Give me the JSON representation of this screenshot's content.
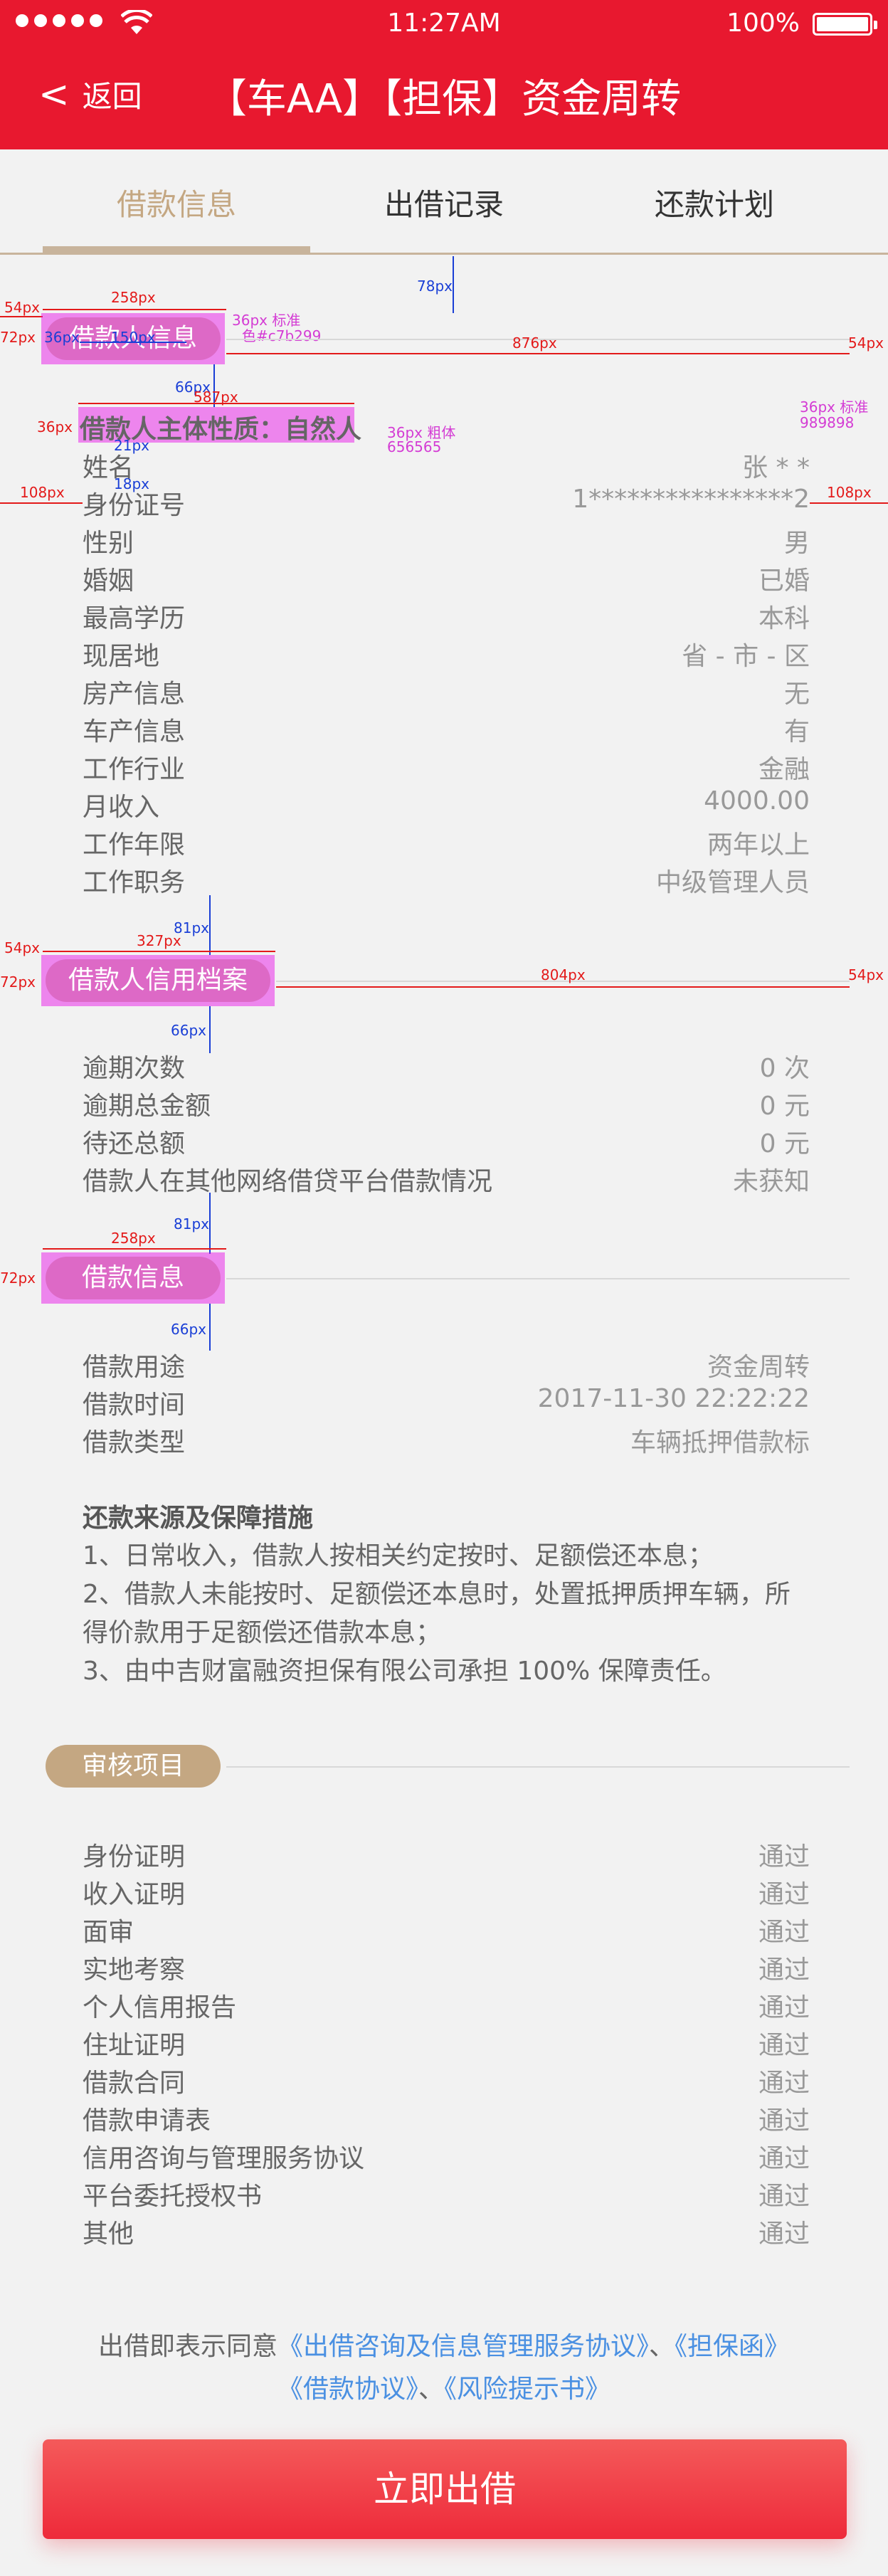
{
  "status_bar": {
    "time": "11:27AM",
    "battery": "100%"
  },
  "nav": {
    "back_label": "返回",
    "title": "【车AA】【担保】资金周转"
  },
  "tabs": [
    {
      "label": "借款信息",
      "active": true
    },
    {
      "label": "出借记录",
      "active": false
    },
    {
      "label": "还款计划",
      "active": false
    }
  ],
  "section1": {
    "pill": "借款人信息",
    "subtitle": "借款人主体性质：自然人"
  },
  "borrower": [
    {
      "label": "姓名",
      "value": "张 * *"
    },
    {
      "label": "身份证号",
      "value": "1****************2"
    },
    {
      "label": "性别",
      "value": "男"
    },
    {
      "label": "婚姻",
      "value": "已婚"
    },
    {
      "label": "最高学历",
      "value": "本科"
    },
    {
      "label": "现居地",
      "value": "省 - 市 - 区"
    },
    {
      "label": "房产信息",
      "value": "无"
    },
    {
      "label": "车产信息",
      "value": "有"
    },
    {
      "label": "工作行业",
      "value": "金融"
    },
    {
      "label": "月收入",
      "value": "4000.00"
    },
    {
      "label": "工作年限",
      "value": "两年以上"
    },
    {
      "label": "工作职务",
      "value": "中级管理人员"
    }
  ],
  "section2": {
    "pill": "借款人信用档案"
  },
  "credit": [
    {
      "label": "逾期次数",
      "value": "0 次"
    },
    {
      "label": "逾期总金额",
      "value": "0 元"
    },
    {
      "label": "待还总额",
      "value": "0 元"
    },
    {
      "label": "借款人在其他网络借贷平台借款情况",
      "value": "未获知"
    }
  ],
  "section3": {
    "pill": "借款信息"
  },
  "loan": [
    {
      "label": "借款用途",
      "value": "资金周转"
    },
    {
      "label": "借款时间",
      "value": "2017-11-30 22:22:22"
    },
    {
      "label": "借款类型",
      "value": "车辆抵押借款标"
    }
  ],
  "repayment": {
    "heading": "还款来源及保障措施",
    "p1": "1、日常收入，借款人按相关约定按时、足额偿还本息；",
    "p2": "2、借款人未能按时、足额偿还本息时，处置抵押质押车辆，所得价款用于足额偿还借款本息；",
    "p3": "3、由中吉财富融资担保有限公司承担 100% 保障责任。"
  },
  "section4": {
    "pill": "审核项目"
  },
  "audit": [
    {
      "label": "身份证明",
      "value": "通过"
    },
    {
      "label": "收入证明",
      "value": "通过"
    },
    {
      "label": "面审",
      "value": "通过"
    },
    {
      "label": "实地考察",
      "value": "通过"
    },
    {
      "label": "个人信用报告",
      "value": "通过"
    },
    {
      "label": "住址证明",
      "value": "通过"
    },
    {
      "label": "借款合同",
      "value": "通过"
    },
    {
      "label": "借款申请表",
      "value": "通过"
    },
    {
      "label": "信用咨询与管理服务协议",
      "value": "通过"
    },
    {
      "label": "平台委托授权书",
      "value": "通过"
    },
    {
      "label": "其他",
      "value": "通过"
    }
  ],
  "agreement": {
    "prefix": "出借即表示同意",
    "link1": "《出借咨询及信息管理服务协议》",
    "sep1": "、",
    "link2": "《担保函》",
    "link3": "《借款协议》",
    "sep2": "、",
    "link4": "《风险提示书》"
  },
  "cta": "立即出借",
  "annotations": {
    "a_54px_1": "54px",
    "a_258px_1": "258px",
    "a_36px_std": "36px 标准",
    "a_color_1": "色#c7b299",
    "a_72px_1": "72px",
    "a_36px_1": "36px",
    "a_150px": "150px",
    "a_876px": "876px",
    "a_54px_r1": "54px",
    "a_78px": "78px",
    "a_66px_1": "66px",
    "a_587px": "587px",
    "a_36px_side": "36px",
    "a_36px_bold": "36px 粗体",
    "a_656565": "656565",
    "a_36px_std2": "36px 标准",
    "a_989898": "989898",
    "a_21px": "21px",
    "a_18px": "18px",
    "a_108px_l": "108px",
    "a_108px_r": "108px",
    "a_81px_1": "81px",
    "a_54px_2": "54px",
    "a_327px": "327px",
    "a_72px_2": "72px",
    "a_804px": "804px",
    "a_54px_r2": "54px",
    "a_66px_2": "66px",
    "a_81px_2": "81px",
    "a_258px_2": "258px",
    "a_72px_3": "72px",
    "a_66px_3": "66px"
  }
}
